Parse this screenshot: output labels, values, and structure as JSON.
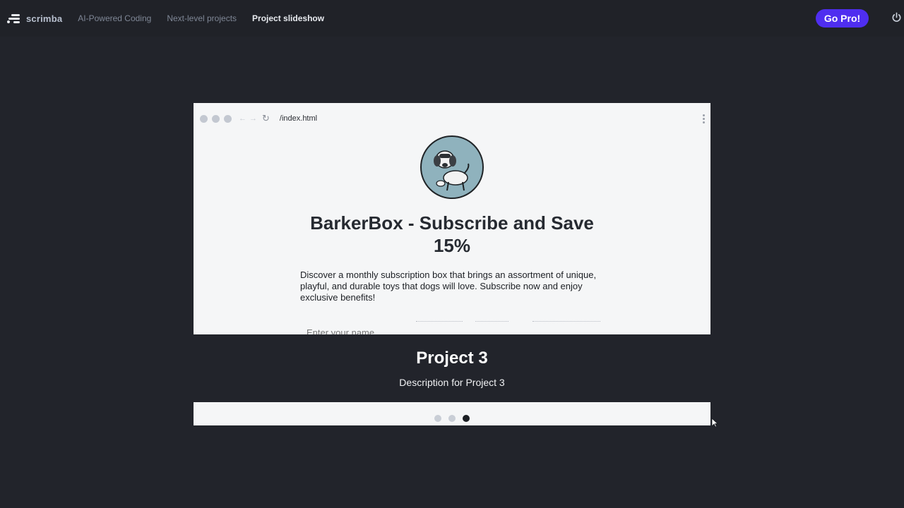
{
  "nav": {
    "logo_text": "scrimba",
    "breadcrumbs": [
      "AI-Powered Coding",
      "Next-level projects",
      "Project slideshow"
    ],
    "go_pro_label": "Go Pro!",
    "accent_color": "#4f2ef0"
  },
  "browser": {
    "url": "/index.html"
  },
  "site": {
    "heading": "BarkerBox - Subscribe and Save 15%",
    "description": "Discover a monthly subscription box that brings an assortment of unique, playful, and durable toys that dogs will love. Subscribe now and enjoy exclusive benefits!",
    "name_placeholder": "Enter your name"
  },
  "slide": {
    "title": "Project 3",
    "description": "Description for Project 3",
    "total": 3,
    "active_index": 3
  },
  "icons": [
    "scrimba-logo-icon",
    "power-icon",
    "back-arrow-icon",
    "forward-arrow-icon",
    "reload-icon",
    "kebab-menu-icon",
    "dog-avatar-icon",
    "mouse-cursor-icon"
  ]
}
